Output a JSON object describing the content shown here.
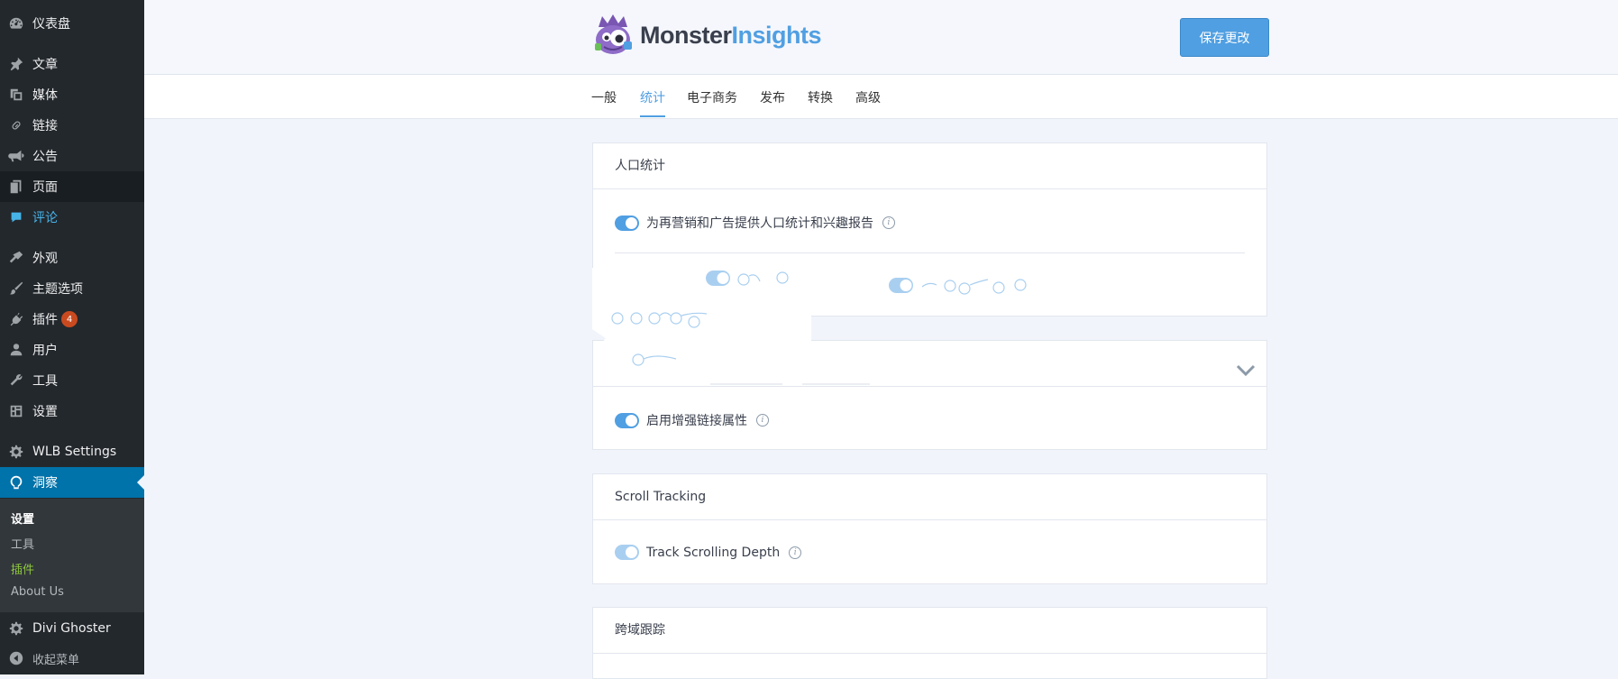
{
  "sidebar": {
    "items": [
      {
        "label": "仪表盘",
        "icon": "dashboard-icon"
      },
      {
        "label": "文章",
        "icon": "pin-icon"
      },
      {
        "label": "媒体",
        "icon": "media-icon"
      },
      {
        "label": "链接",
        "icon": "link-icon"
      },
      {
        "label": "公告",
        "icon": "megaphone-icon"
      },
      {
        "label": "页面",
        "icon": "pages-icon"
      },
      {
        "label": "评论",
        "icon": "comments-icon"
      },
      {
        "label": "外观",
        "icon": "appearance-icon"
      },
      {
        "label": "主题选项",
        "icon": "brush-icon"
      },
      {
        "label": "插件",
        "icon": "plugin-icon",
        "badge": "4"
      },
      {
        "label": "用户",
        "icon": "user-icon"
      },
      {
        "label": "工具",
        "icon": "wrench-icon"
      },
      {
        "label": "设置",
        "icon": "settings-icon"
      },
      {
        "label": "WLB Settings",
        "icon": "gear-icon"
      },
      {
        "label": "洞察",
        "icon": "insights-icon"
      }
    ],
    "submenu": [
      "设置",
      "工具",
      "插件",
      "About Us"
    ],
    "divi_ghoster": "Divi Ghoster",
    "collapse": "收起菜单"
  },
  "header": {
    "brand_part1": "Monster",
    "brand_part2": "Insights",
    "save_label": "保存更改"
  },
  "tabs": [
    "一般",
    "统计",
    "电子商务",
    "发布",
    "转换",
    "高级"
  ],
  "active_tab": "统计",
  "cards": {
    "demographics": {
      "title": "人口统计",
      "toggle_label": "为再营销和广告提供人口统计和兴趣报告"
    },
    "links": {
      "toggle_label": "启用增强链接属性"
    },
    "scroll": {
      "title": "Scroll Tracking",
      "toggle_label": "Track Scrolling Depth"
    },
    "crossdomain": {
      "title": "跨域跟踪"
    }
  },
  "colors": {
    "accent": "#509fe2",
    "sidebar_bg": "#23282d",
    "active_menu": "#0073aa",
    "badge": "#ca4a1f"
  }
}
